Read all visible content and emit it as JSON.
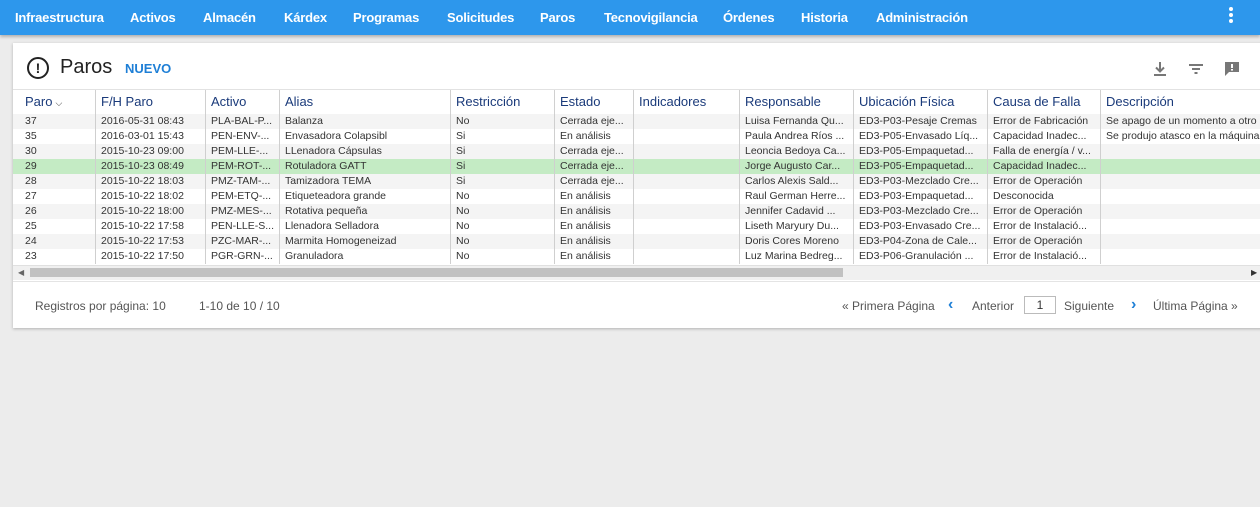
{
  "nav": {
    "items": [
      {
        "label": "Infraestructura"
      },
      {
        "label": "Activos"
      },
      {
        "label": "Almacén"
      },
      {
        "label": "Kárdex"
      },
      {
        "label": "Programas"
      },
      {
        "label": "Solicitudes"
      },
      {
        "label": "Paros"
      },
      {
        "label": "Tecnovigilancia"
      },
      {
        "label": "Órdenes"
      },
      {
        "label": "Historia"
      },
      {
        "label": "Administración"
      }
    ],
    "menu_icon": "more-vert-icon"
  },
  "header": {
    "title": "Paros",
    "new_label": "NUEVO",
    "title_icon": "alert-circle-icon",
    "tools": [
      "download-icon",
      "filter-icon",
      "feedback-icon"
    ]
  },
  "table": {
    "columns": [
      "Paro",
      "F/H Paro",
      "Activo",
      "Alias",
      "Restricción",
      "Estado",
      "Indicadores",
      "Responsable",
      "Ubicación Física",
      "Causa de Falla",
      "Descripción"
    ],
    "sort_icon": "chevron-down-icon",
    "selected_row": 3,
    "rows": [
      [
        "37",
        "2016-05-31 08:43",
        "PLA-BAL-P...",
        "Balanza",
        "No",
        "Cerrada eje...",
        "",
        "Luisa Fernanda Qu...",
        "ED3-P03-Pesaje Cremas",
        "Error de Fabricación",
        "Se apago de un momento a otro"
      ],
      [
        "35",
        "2016-03-01 15:43",
        "PEN-ENV-...",
        "Envasadora Colapsibl",
        "Si",
        "En análisis",
        "",
        "Paula Andrea Ríos ...",
        "ED3-P05-Envasado Líq...",
        "Capacidad Inadec...",
        "Se produjo atasco en la máquina"
      ],
      [
        "30",
        "2015-10-23 09:00",
        "PEM-LLE-...",
        "LLenadora Cápsulas",
        "Si",
        "Cerrada eje...",
        "",
        "Leoncia Bedoya Ca...",
        "ED3-P05-Empaquetad...",
        "Falla de energía / v...",
        ""
      ],
      [
        "29",
        "2015-10-23 08:49",
        "PEM-ROT-...",
        "Rotuladora GATT",
        "Si",
        "Cerrada eje...",
        "",
        "Jorge Augusto Car...",
        "ED3-P05-Empaquetad...",
        "Capacidad Inadec...",
        ""
      ],
      [
        "28",
        "2015-10-22 18:03",
        "PMZ-TAM-...",
        "Tamizadora TEMA",
        "Si",
        "Cerrada eje...",
        "",
        "Carlos Alexis Sald...",
        "ED3-P03-Mezclado Cre...",
        "Error de Operación",
        ""
      ],
      [
        "27",
        "2015-10-22 18:02",
        "PEM-ETQ-...",
        "Etiqueteadora grande",
        "No",
        "En análisis",
        "",
        "Raul German Herre...",
        "ED3-P03-Empaquetad...",
        "Desconocida",
        ""
      ],
      [
        "26",
        "2015-10-22 18:00",
        "PMZ-MES-...",
        "Rotativa pequeña",
        "No",
        "En análisis",
        "",
        "Jennifer Cadavid ...",
        "ED3-P03-Mezclado Cre...",
        "Error de Operación",
        ""
      ],
      [
        "25",
        "2015-10-22 17:58",
        "PEN-LLE-S...",
        "Llenadora Selladora",
        "No",
        "En análisis",
        "",
        "Liseth Maryury Du...",
        "ED3-P03-Envasado Cre...",
        "Error de Instalació...",
        ""
      ],
      [
        "24",
        "2015-10-22 17:53",
        "PZC-MAR-...",
        "Marmita Homogeneizad",
        "No",
        "En análisis",
        "",
        "Doris Cores Moreno",
        "ED3-P04-Zona de Cale...",
        "Error de Operación",
        ""
      ],
      [
        "23",
        "2015-10-22 17:50",
        "PGR-GRN-...",
        "Granuladora",
        "No",
        "En análisis",
        "",
        "Luz Marina Bedreg...",
        "ED3-P06-Granulación ...",
        "Error de Instalació...",
        ""
      ]
    ]
  },
  "pagination": {
    "per_page_label": "Registros por página: 10",
    "range": "1-10 de 10 / 10",
    "first": "« Primera Página",
    "prev": "Anterior",
    "page": "1",
    "next": "Siguiente",
    "last": "Última Página »",
    "prev_icon": "chevron-left-icon",
    "next_icon": "chevron-right-icon"
  },
  "colors": {
    "nav_bg": "#2d97ec",
    "accent": "#1e7fd6",
    "selected_row": "#c4ebc4",
    "header_text": "#1a3a7a"
  }
}
